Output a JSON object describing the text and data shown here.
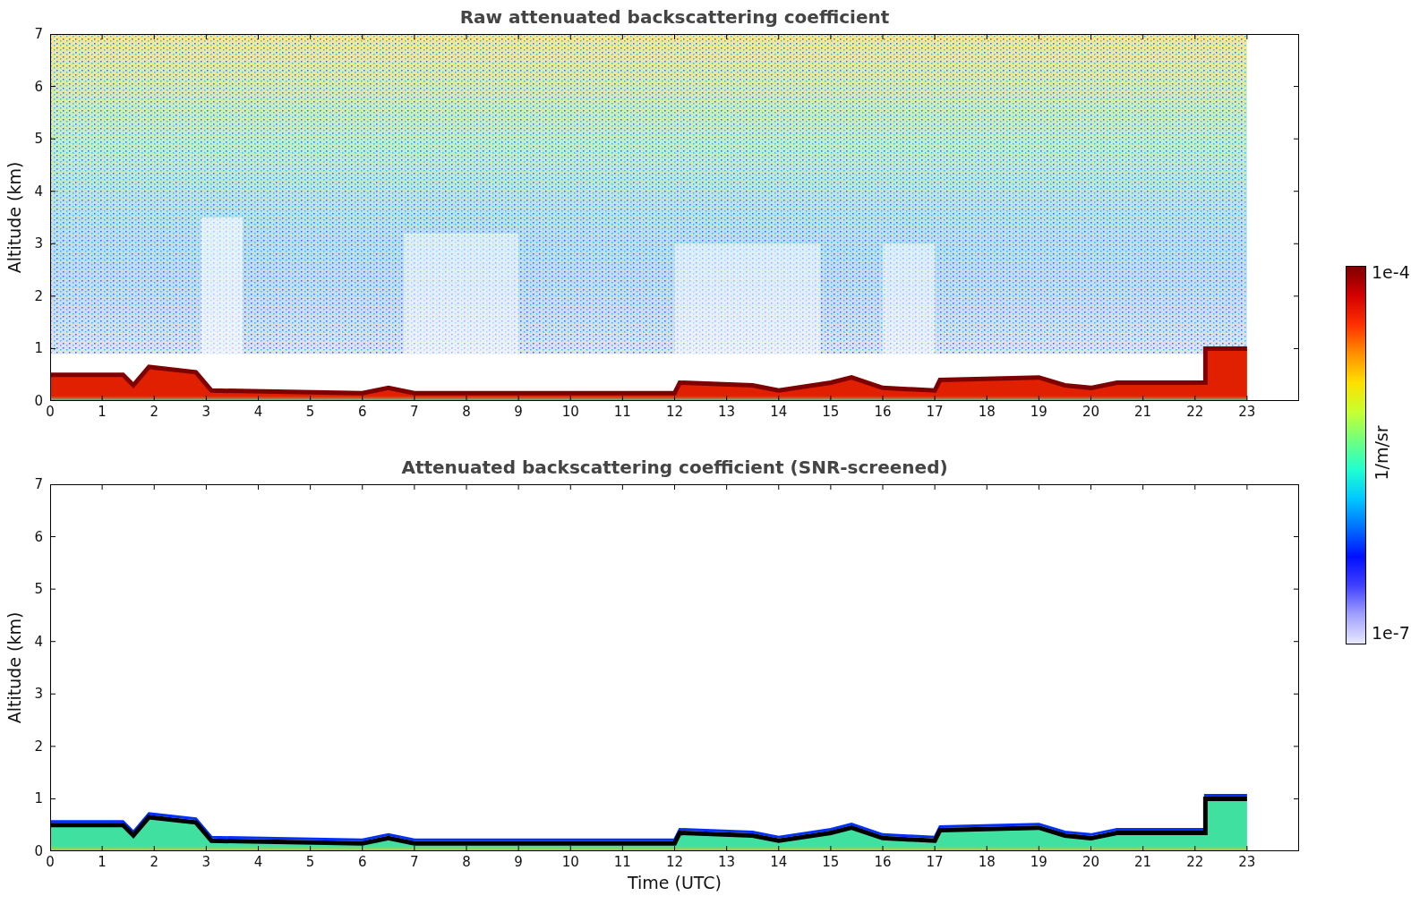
{
  "panels": [
    {
      "kind": "raw",
      "title": "Raw attenuated backscattering coefficient",
      "ylabel": "Altitude (km)",
      "yticks": [
        "7",
        "6",
        "5",
        "4",
        "3",
        "2",
        "1",
        "0"
      ],
      "xticks": [
        "0",
        "1",
        "2",
        "3",
        "4",
        "5",
        "6",
        "7",
        "8",
        "9",
        "10",
        "11",
        "12",
        "13",
        "14",
        "15",
        "16",
        "17",
        "18",
        "19",
        "20",
        "21",
        "22",
        "23"
      ]
    },
    {
      "kind": "screened",
      "title": "Attenuated backscattering coefficient (SNR-screened)",
      "ylabel": "Altitude (km)",
      "yticks": [
        "7",
        "6",
        "5",
        "4",
        "3",
        "2",
        "1",
        "0"
      ],
      "xticks": [
        "0",
        "1",
        "2",
        "3",
        "4",
        "5",
        "6",
        "7",
        "8",
        "9",
        "10",
        "11",
        "12",
        "13",
        "14",
        "15",
        "16",
        "17",
        "18",
        "19",
        "20",
        "21",
        "22",
        "23"
      ],
      "xlabel": "Time (UTC)"
    }
  ],
  "colorbar": {
    "max_label": "1e-4",
    "min_label": "1e-7",
    "unit": "1/m/sr"
  }
}
